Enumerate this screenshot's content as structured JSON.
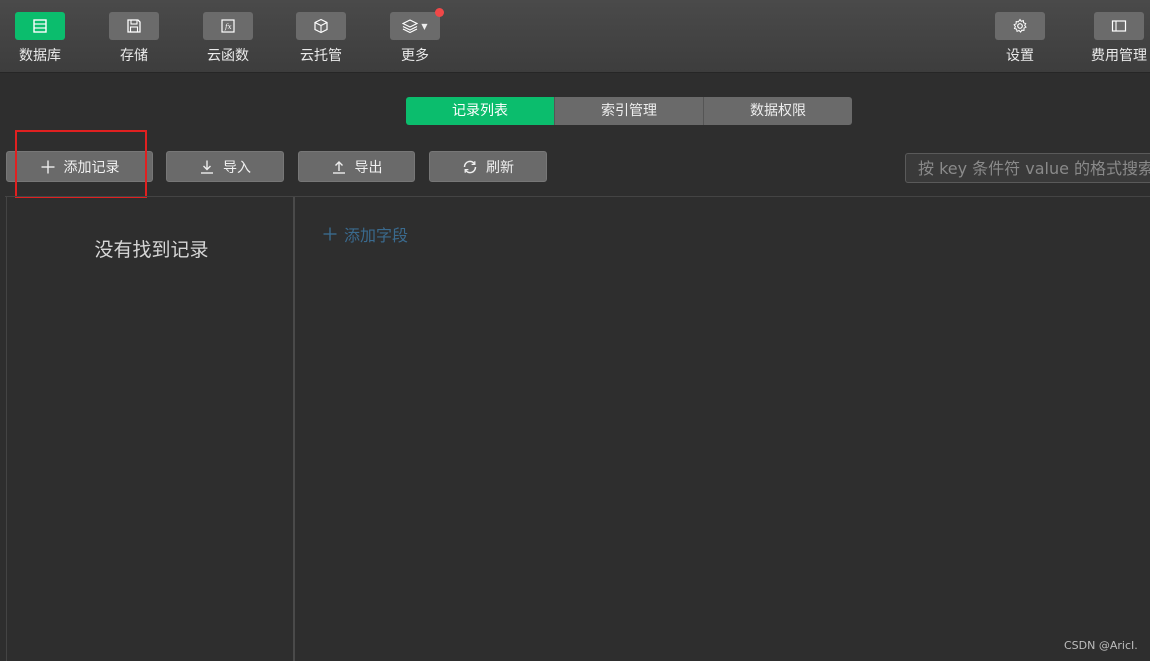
{
  "toolbar": {
    "items": [
      {
        "label": "数据库",
        "icon": "database-icon",
        "active": true
      },
      {
        "label": "存储",
        "icon": "storage-icon",
        "active": false
      },
      {
        "label": "云函数",
        "icon": "function-icon",
        "active": false
      },
      {
        "label": "云托管",
        "icon": "box-icon",
        "active": false
      },
      {
        "label": "更多",
        "icon": "layers-icon",
        "active": false
      }
    ],
    "right_items": [
      {
        "label": "设置",
        "icon": "gear-icon"
      },
      {
        "label": "费用管理",
        "icon": "billing-icon"
      }
    ]
  },
  "tabs": [
    {
      "label": "记录列表",
      "active": true
    },
    {
      "label": "索引管理",
      "active": false
    },
    {
      "label": "数据权限",
      "active": false
    }
  ],
  "actions": {
    "add_record": "添加记录",
    "import": "导入",
    "export": "导出",
    "refresh": "刷新"
  },
  "search": {
    "placeholder": "按 key 条件符 value 的格式搜索"
  },
  "records": {
    "empty_text": "没有找到记录"
  },
  "fields": {
    "add_label": "添加字段"
  },
  "watermark": "CSDN @AricI.",
  "colors": {
    "accent": "#0bbd6d",
    "highlight": "#e02020",
    "background": "#2e2e2e"
  }
}
